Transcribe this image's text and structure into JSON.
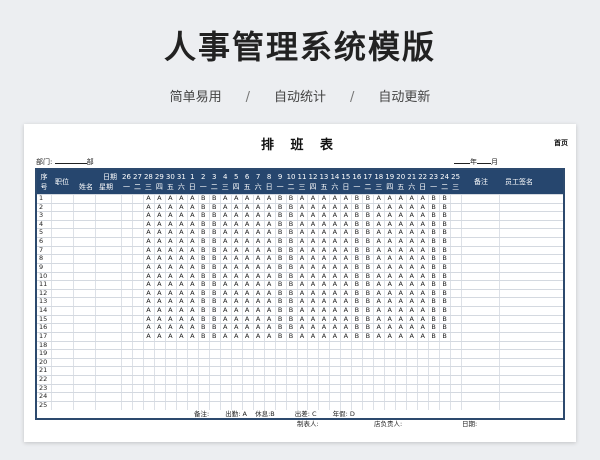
{
  "banner": {
    "title": "人事管理系统模版",
    "features": [
      "简单易用",
      "自动统计",
      "自动更新"
    ],
    "separator": "/"
  },
  "sheet": {
    "home_link": "首页",
    "title": "排 班 表",
    "dept_label": "部门:",
    "dept_suffix": "部",
    "year_label": "年",
    "month_label": "月",
    "header": {
      "seq_top": "序",
      "seq_bottom": "号",
      "position": "职位",
      "date": "日期",
      "name": "姓名",
      "weekday": "星期",
      "remark": "备注",
      "signature": "员工签名",
      "dates": [
        "26",
        "27",
        "28",
        "29",
        "30",
        "31",
        "1",
        "2",
        "3",
        "4",
        "5",
        "6",
        "7",
        "8",
        "9",
        "10",
        "11",
        "12",
        "13",
        "14",
        "15",
        "16",
        "17",
        "18",
        "19",
        "20",
        "21",
        "22",
        "23",
        "24",
        "25"
      ],
      "weekdays": [
        "一",
        "二",
        "三",
        "四",
        "五",
        "六",
        "日",
        "一",
        "二",
        "三",
        "四",
        "五",
        "六",
        "日",
        "一",
        "二",
        "三",
        "四",
        "五",
        "六",
        "日",
        "一",
        "二",
        "三",
        "四",
        "五",
        "六",
        "日",
        "一",
        "二",
        "三"
      ]
    },
    "row_numbers": [
      "1",
      "2",
      "3",
      "4",
      "5",
      "6",
      "7",
      "8",
      "9",
      "10",
      "11",
      "12",
      "13",
      "14",
      "15",
      "16",
      "17",
      "18",
      "19",
      "20",
      "21",
      "22",
      "23",
      "24",
      "25"
    ],
    "shift_pattern": [
      "A",
      "A",
      "A",
      "A",
      "A",
      "B",
      "B",
      "A",
      "A",
      "A",
      "A",
      "A",
      "B",
      "B",
      "A",
      "A",
      "A",
      "A",
      "A",
      "B",
      "B",
      "A",
      "A",
      "A",
      "A",
      "A",
      "B",
      "B"
    ],
    "filled_rows": 17,
    "footer": {
      "remark_label": "备注:",
      "attend": "出勤:  A",
      "rest": "休息:B",
      "business": "出差:  C",
      "leave": "年假:  D",
      "maker": "制表人:",
      "manager": "店负责人:",
      "date": "日期:"
    }
  }
}
